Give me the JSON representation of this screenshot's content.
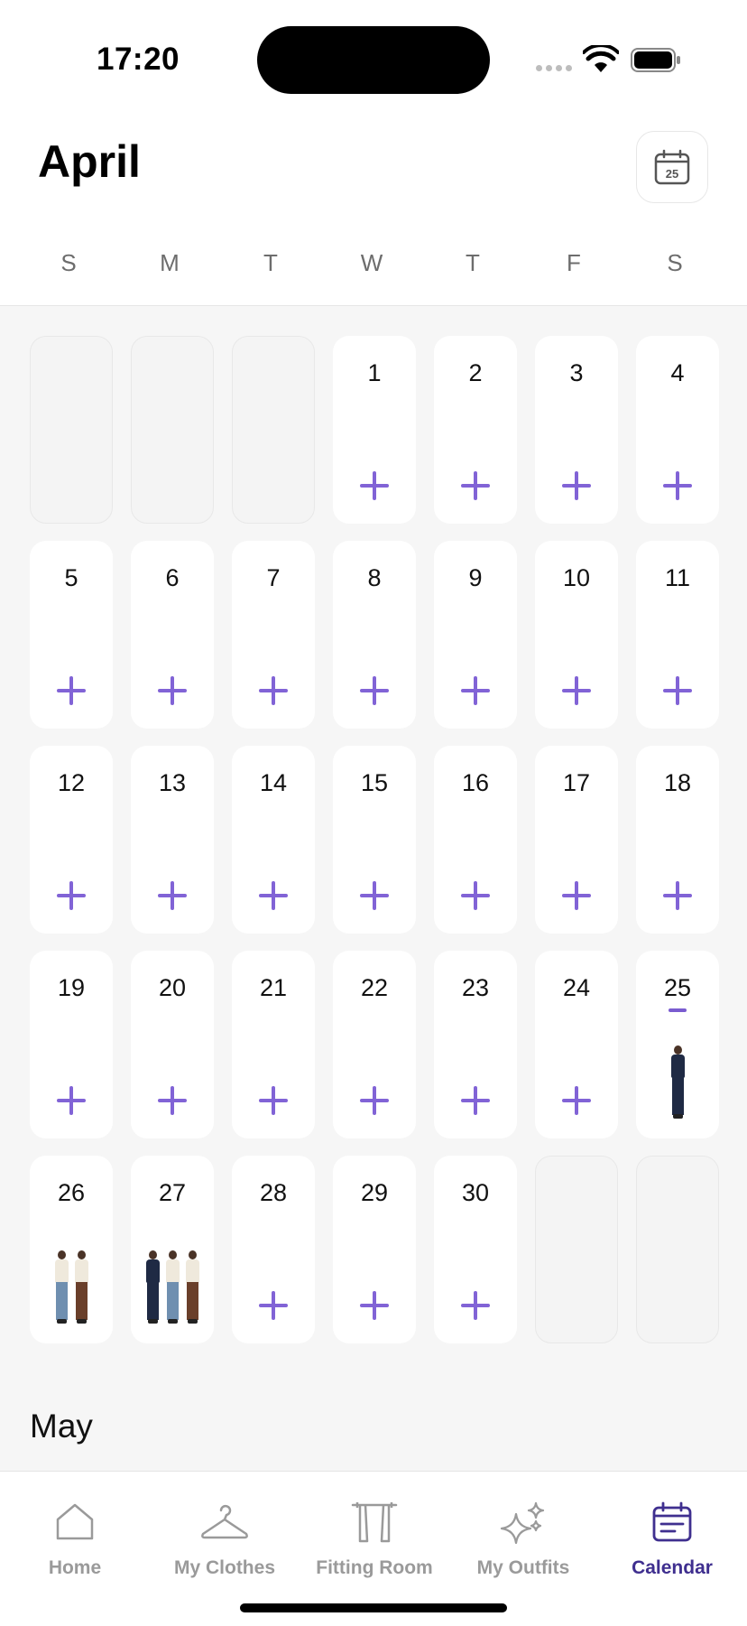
{
  "status": {
    "time": "17:20"
  },
  "header": {
    "month": "April",
    "today_icon_number": "25"
  },
  "weekdays": [
    "S",
    "M",
    "T",
    "W",
    "T",
    "F",
    "S"
  ],
  "calendar": {
    "cells": [
      {
        "empty": true
      },
      {
        "empty": true
      },
      {
        "empty": true
      },
      {
        "day": "1"
      },
      {
        "day": "2"
      },
      {
        "day": "3"
      },
      {
        "day": "4"
      },
      {
        "day": "5"
      },
      {
        "day": "6"
      },
      {
        "day": "7"
      },
      {
        "day": "8"
      },
      {
        "day": "9"
      },
      {
        "day": "10"
      },
      {
        "day": "11"
      },
      {
        "day": "12"
      },
      {
        "day": "13"
      },
      {
        "day": "14"
      },
      {
        "day": "15"
      },
      {
        "day": "16"
      },
      {
        "day": "17"
      },
      {
        "day": "18"
      },
      {
        "day": "19"
      },
      {
        "day": "20"
      },
      {
        "day": "21"
      },
      {
        "day": "22"
      },
      {
        "day": "23"
      },
      {
        "day": "24"
      },
      {
        "day": "25",
        "today": true,
        "outfit": [
          "navy"
        ]
      },
      {
        "day": "26",
        "outfit": [
          "cream-jeans",
          "cream-brown"
        ]
      },
      {
        "day": "27",
        "outfit": [
          "navy",
          "cream-jeans",
          "cream-brown"
        ]
      },
      {
        "day": "28"
      },
      {
        "day": "29"
      },
      {
        "day": "30"
      },
      {
        "empty": true
      },
      {
        "empty": true
      }
    ]
  },
  "next_month": "May",
  "tabbar": {
    "tabs": [
      {
        "label": "Home",
        "icon": "home-icon",
        "active": false
      },
      {
        "label": "My Clothes",
        "icon": "hanger-icon",
        "active": false
      },
      {
        "label": "Fitting Room",
        "icon": "fitting-room-icon",
        "active": false
      },
      {
        "label": "My Outfits",
        "icon": "sparkles-icon",
        "active": false
      },
      {
        "label": "Calendar",
        "icon": "calendar-icon",
        "active": true
      }
    ]
  },
  "colors": {
    "accent": "#8163d6",
    "active_tab": "#3f2f8f",
    "inactive_tab": "#9a9a9a"
  }
}
